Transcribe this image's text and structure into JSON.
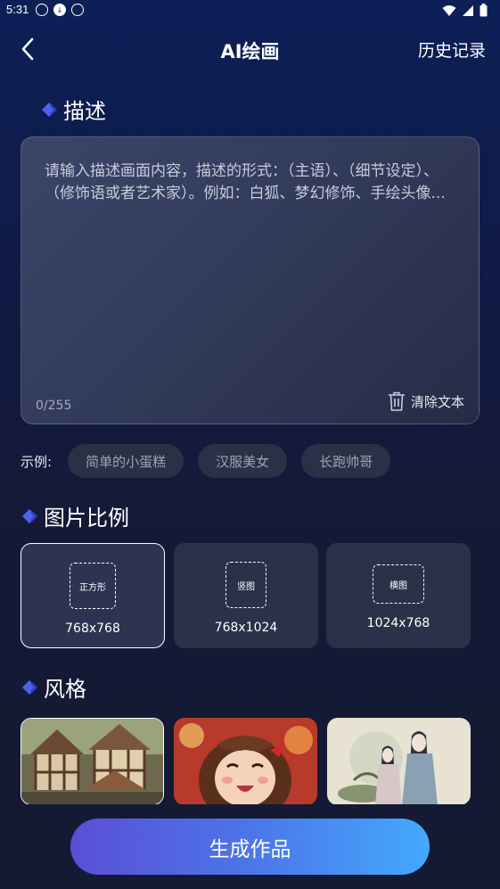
{
  "status_bar": {
    "time": "5:31"
  },
  "header": {
    "title": "AI绘画",
    "history": "历史记录"
  },
  "description": {
    "section_title": "描述",
    "placeholder": "请输入描述画面内容，描述的形式：（主语）、（细节设定）、（修饰语或者艺术家）。例如：白狐、梦幻修饰、手绘头像...",
    "counter": "0/255",
    "clear_label": "清除文本"
  },
  "examples": {
    "label": "示例:",
    "chips": [
      "简单的小蛋糕",
      "汉服美女",
      "长跑帅哥"
    ]
  },
  "ratio": {
    "section_title": "图片比例",
    "options": [
      {
        "frame_label": "正方形",
        "size": "768x768",
        "selected": true
      },
      {
        "frame_label": "竖图",
        "size": "768x1024",
        "selected": false
      },
      {
        "frame_label": "横图",
        "size": "1024x768",
        "selected": false
      }
    ]
  },
  "style": {
    "section_title": "风格",
    "options": [
      "village-miniature",
      "anime-girl",
      "ink-painting"
    ]
  },
  "generate_label": "生成作品",
  "colors": {
    "accent": "#4a6cf0",
    "button_start": "#5a4fd6",
    "button_end": "#44a9ff"
  }
}
